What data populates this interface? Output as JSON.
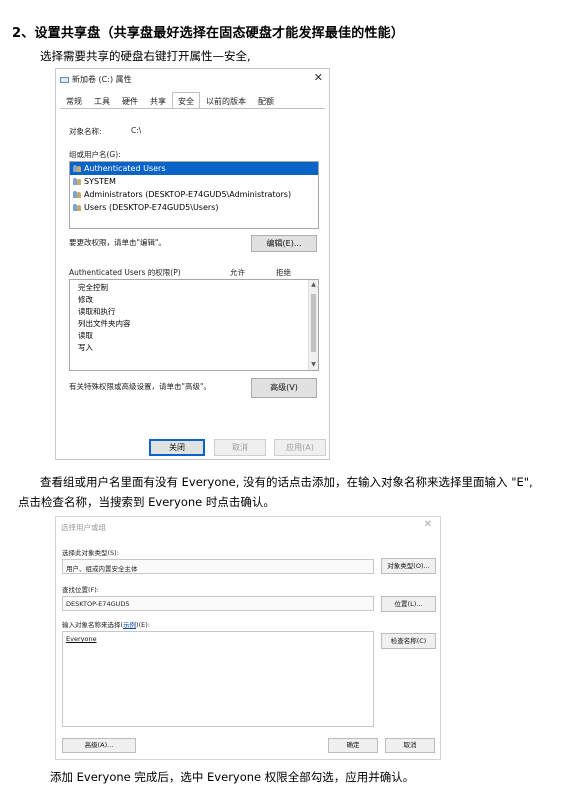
{
  "heading": "2、设置共享盘（共享盘最好选择在固态硬盘才能发挥最佳的性能）",
  "intro": "选择需要共享的硬盘右键打开属性—安全,",
  "properties_dialog": {
    "title": "新加卷 (C:) 属性",
    "close": "✕",
    "tabs": [
      "常规",
      "工具",
      "硬件",
      "共享",
      "安全",
      "以前的版本",
      "配额"
    ],
    "object_label": "对象名称:",
    "object_value": "C:\\",
    "group_label": "组或用户名(G):",
    "users": [
      "Authenticated Users",
      "SYSTEM",
      "Administrators (DESKTOP-E74GUD5\\Administrators)",
      "Users (DESKTOP-E74GUD5\\Users)"
    ],
    "edit_hint": "要更改权限，请单击\"编辑\"。",
    "edit_button": "编辑(E)...",
    "perm_header": "Authenticated Users 的权限(P)",
    "allow": "允许",
    "deny": "拒绝",
    "permissions": [
      "完全控制",
      "修改",
      "读取和执行",
      "列出文件夹内容",
      "读取",
      "写入"
    ],
    "advanced_hint": "有关特殊权限或高级设置，请单击\"高级\"。",
    "advanced_button": "高级(V)",
    "ok": "关闭",
    "cancel": "取消",
    "apply": "应用(A)",
    "scroll_up": "▲",
    "scroll_down": "▼"
  },
  "para2_line1": "查看组或用户名里面有没有 Everyone, 没有的话点击添加，在输入对象名称来选择里面输入 \"E\",",
  "para2_line2": "点击检查名称，当搜索到 Everyone 时点击确认。",
  "select_dialog": {
    "title": "选择用户或组",
    "close": "✕",
    "type_label": "选择此对象类型(S):",
    "type_value": "用户、组或内置安全主体",
    "type_button": "对象类型(O)...",
    "location_label": "查找位置(F):",
    "location_value": "DESKTOP-E74GUD5",
    "location_button": "位置(L)...",
    "enter_label": "输入对象名称来选择(",
    "enter_link": "示例",
    "enter_label_end": ")(E):",
    "entered_value": "Everyone",
    "check_button": "检查名称(C)",
    "advanced_button": "高级(A)...",
    "ok": "确定",
    "cancel": "取消",
    "grip": "⋰"
  },
  "final": "添加 Everyone 完成后，选中 Everyone 权限全部勾选，应用并确认。"
}
